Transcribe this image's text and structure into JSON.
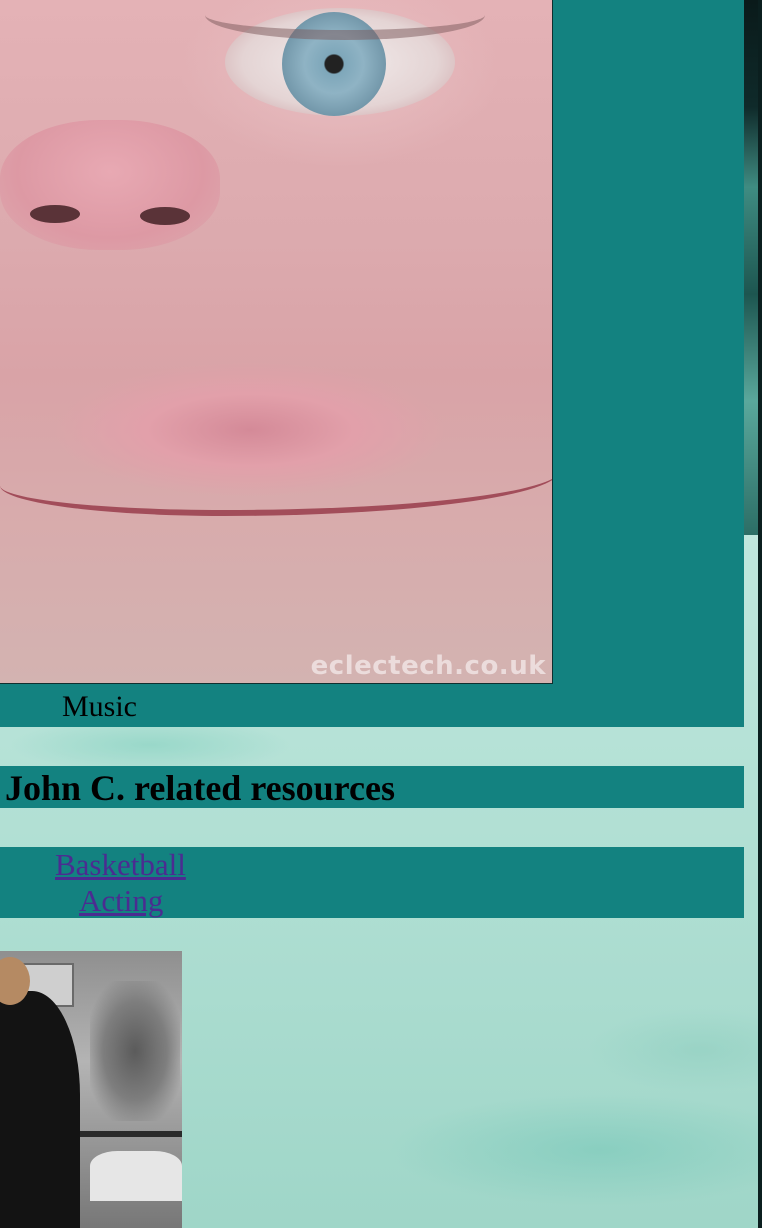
{
  "top_section": {
    "photo_watermark": "eclectech.co.uk",
    "caption": "Music"
  },
  "resources": {
    "heading": "e John C. related resources",
    "links": [
      {
        "label": "Basketball"
      },
      {
        "label": "Acting"
      }
    ]
  },
  "colors": {
    "panel": "#138280",
    "link": "#4b2c91",
    "background": "#b6e2d7"
  }
}
